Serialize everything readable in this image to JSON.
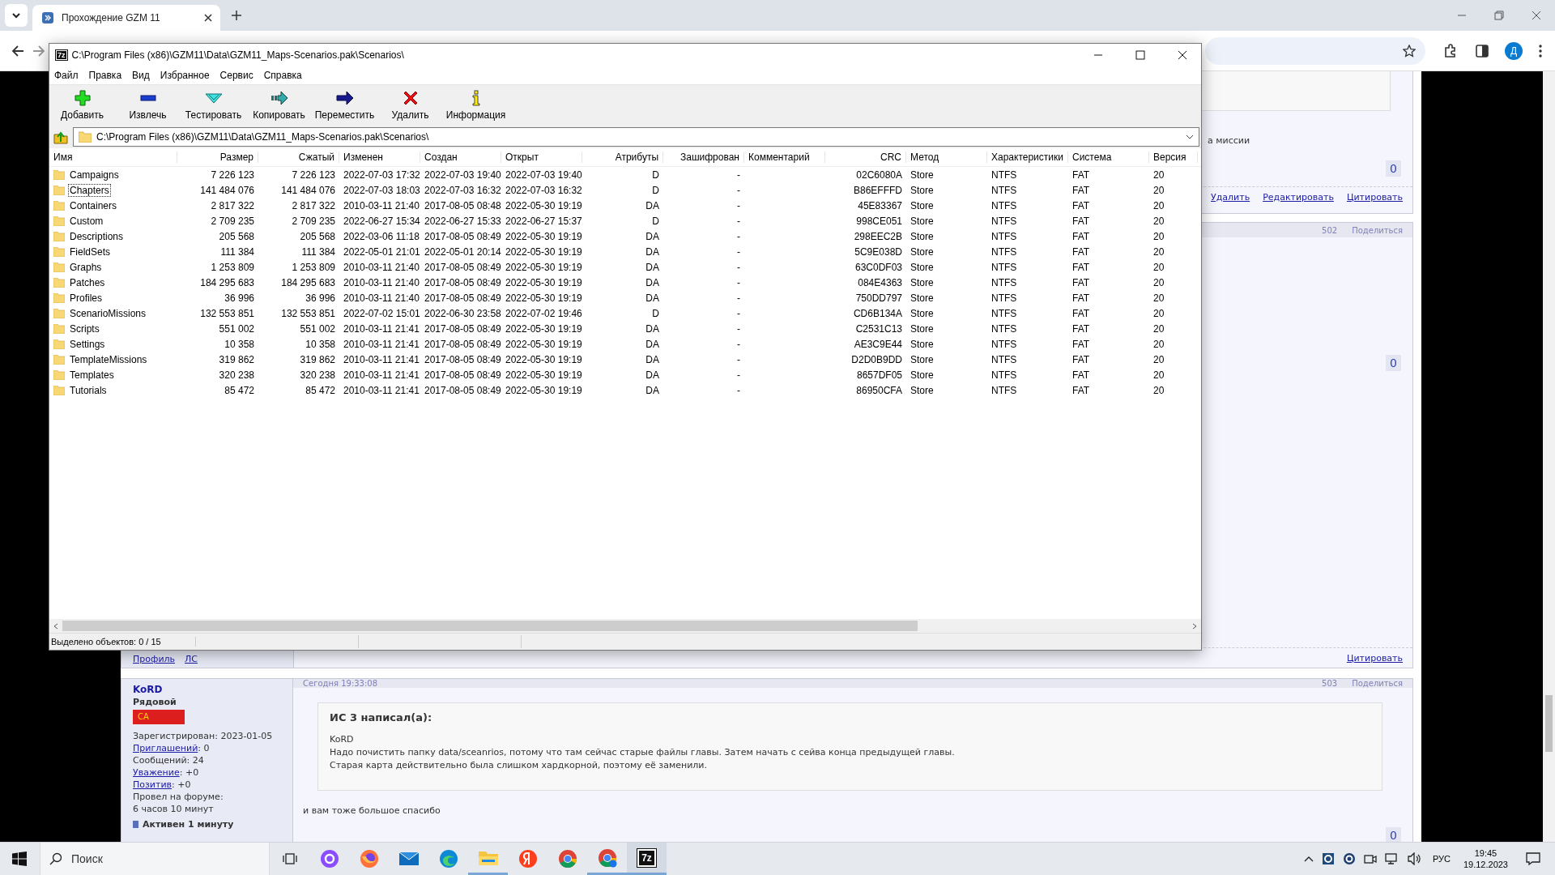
{
  "browser": {
    "tab": {
      "title": "Прохождение GZM 11"
    },
    "profile_initial": "Д"
  },
  "archiver": {
    "title_icon": "7z",
    "title": "C:\\Program Files (x86)\\GZM11\\Data\\GZM11_Maps-Scenarios.pak\\Scenarios\\",
    "menu": [
      "Файл",
      "Правка",
      "Вид",
      "Избранное",
      "Сервис",
      "Справка"
    ],
    "toolbar": [
      {
        "kind": "add",
        "label": "Добавить"
      },
      {
        "kind": "extract",
        "label": "Извлечь"
      },
      {
        "kind": "test",
        "label": "Тестировать"
      },
      {
        "kind": "copy",
        "label": "Копировать"
      },
      {
        "kind": "move",
        "label": "Переместить"
      },
      {
        "kind": "delete",
        "label": "Удалить"
      },
      {
        "kind": "info",
        "label": "Информация"
      }
    ],
    "path": "C:\\Program Files (x86)\\GZM11\\Data\\GZM11_Maps-Scenarios.pak\\Scenarios\\",
    "columns": [
      "Имя",
      "Размер",
      "Сжатый",
      "Изменен",
      "Создан",
      "Открыт",
      "Атрибуты",
      "Зашифрован",
      "Комментарий",
      "CRC",
      "Метод",
      "Характеристики",
      "Система",
      "Версия"
    ],
    "rows": [
      {
        "name": "Campaigns",
        "focused": false,
        "size": "7 226 123",
        "packed": "7 226 123",
        "modified": "2022-07-03 17:32",
        "created": "2022-07-03 19:40",
        "accessed": "2022-07-03 19:40",
        "attributes": "D",
        "encrypted": "-",
        "crc": "02C6080A",
        "method": "Store",
        "characteristics": "NTFS",
        "system": "FAT",
        "version": "20"
      },
      {
        "name": "Chapters",
        "focused": true,
        "size": "141 484 076",
        "packed": "141 484 076",
        "modified": "2022-07-03 18:03",
        "created": "2022-07-03 16:32",
        "accessed": "2022-07-03 16:32",
        "attributes": "D",
        "encrypted": "-",
        "crc": "B86EFFFD",
        "method": "Store",
        "characteristics": "NTFS",
        "system": "FAT",
        "version": "20"
      },
      {
        "name": "Containers",
        "focused": false,
        "size": "2 817 322",
        "packed": "2 817 322",
        "modified": "2010-03-11 21:40",
        "created": "2017-08-05 08:48",
        "accessed": "2022-05-30 19:19",
        "attributes": "DA",
        "encrypted": "-",
        "crc": "45E83367",
        "method": "Store",
        "characteristics": "NTFS",
        "system": "FAT",
        "version": "20"
      },
      {
        "name": "Custom",
        "focused": false,
        "size": "2 709 235",
        "packed": "2 709 235",
        "modified": "2022-06-27 15:34",
        "created": "2022-06-27 15:33",
        "accessed": "2022-06-27 15:37",
        "attributes": "D",
        "encrypted": "-",
        "crc": "998CE051",
        "method": "Store",
        "characteristics": "NTFS",
        "system": "FAT",
        "version": "20"
      },
      {
        "name": "Descriptions",
        "focused": false,
        "size": "205 568",
        "packed": "205 568",
        "modified": "2022-03-06 11:18",
        "created": "2017-08-05 08:49",
        "accessed": "2022-05-30 19:19",
        "attributes": "DA",
        "encrypted": "-",
        "crc": "298EEC2B",
        "method": "Store",
        "characteristics": "NTFS",
        "system": "FAT",
        "version": "20"
      },
      {
        "name": "FieldSets",
        "focused": false,
        "size": "111 384",
        "packed": "111 384",
        "modified": "2022-05-01 21:01",
        "created": "2022-05-01 20:14",
        "accessed": "2022-05-30 19:19",
        "attributes": "DA",
        "encrypted": "-",
        "crc": "5C9E038D",
        "method": "Store",
        "characteristics": "NTFS",
        "system": "FAT",
        "version": "20"
      },
      {
        "name": "Graphs",
        "focused": false,
        "size": "1 253 809",
        "packed": "1 253 809",
        "modified": "2010-03-11 21:40",
        "created": "2017-08-05 08:49",
        "accessed": "2022-05-30 19:19",
        "attributes": "DA",
        "encrypted": "-",
        "crc": "63C0DF03",
        "method": "Store",
        "characteristics": "NTFS",
        "system": "FAT",
        "version": "20"
      },
      {
        "name": "Patches",
        "focused": false,
        "size": "184 295 683",
        "packed": "184 295 683",
        "modified": "2010-03-11 21:40",
        "created": "2017-08-05 08:49",
        "accessed": "2022-05-30 19:19",
        "attributes": "DA",
        "encrypted": "-",
        "crc": "084E4363",
        "method": "Store",
        "characteristics": "NTFS",
        "system": "FAT",
        "version": "20"
      },
      {
        "name": "Profiles",
        "focused": false,
        "size": "36 996",
        "packed": "36 996",
        "modified": "2010-03-11 21:40",
        "created": "2017-08-05 08:49",
        "accessed": "2022-05-30 19:19",
        "attributes": "DA",
        "encrypted": "-",
        "crc": "750DD797",
        "method": "Store",
        "characteristics": "NTFS",
        "system": "FAT",
        "version": "20"
      },
      {
        "name": "ScenarioMissions",
        "focused": false,
        "size": "132 553 851",
        "packed": "132 553 851",
        "modified": "2022-07-02 15:01",
        "created": "2022-06-30 23:58",
        "accessed": "2022-07-02 19:46",
        "attributes": "D",
        "encrypted": "-",
        "crc": "CD6B134A",
        "method": "Store",
        "characteristics": "NTFS",
        "system": "FAT",
        "version": "20"
      },
      {
        "name": "Scripts",
        "focused": false,
        "size": "551 002",
        "packed": "551 002",
        "modified": "2010-03-11 21:41",
        "created": "2017-08-05 08:49",
        "accessed": "2022-05-30 19:19",
        "attributes": "DA",
        "encrypted": "-",
        "crc": "C2531C13",
        "method": "Store",
        "characteristics": "NTFS",
        "system": "FAT",
        "version": "20"
      },
      {
        "name": "Settings",
        "focused": false,
        "size": "10 358",
        "packed": "10 358",
        "modified": "2010-03-11 21:41",
        "created": "2017-08-05 08:49",
        "accessed": "2022-05-30 19:19",
        "attributes": "DA",
        "encrypted": "-",
        "crc": "AE3C9E44",
        "method": "Store",
        "characteristics": "NTFS",
        "system": "FAT",
        "version": "20"
      },
      {
        "name": "TemplateMissions",
        "focused": false,
        "size": "319 862",
        "packed": "319 862",
        "modified": "2010-03-11 21:41",
        "created": "2017-08-05 08:49",
        "accessed": "2022-05-30 19:19",
        "attributes": "DA",
        "encrypted": "-",
        "crc": "D2D0B9DD",
        "method": "Store",
        "characteristics": "NTFS",
        "system": "FAT",
        "version": "20"
      },
      {
        "name": "Templates",
        "focused": false,
        "size": "320 238",
        "packed": "320 238",
        "modified": "2010-03-11 21:41",
        "created": "2017-08-05 08:49",
        "accessed": "2022-05-30 19:19",
        "attributes": "DA",
        "encrypted": "-",
        "crc": "8657DF05",
        "method": "Store",
        "characteristics": "NTFS",
        "system": "FAT",
        "version": "20"
      },
      {
        "name": "Tutorials",
        "focused": false,
        "size": "85 472",
        "packed": "85 472",
        "modified": "2010-03-11 21:41",
        "created": "2017-08-05 08:49",
        "accessed": "2022-05-30 19:19",
        "attributes": "DA",
        "encrypted": "-",
        "crc": "86950CFA",
        "method": "Store",
        "characteristics": "NTFS",
        "system": "FAT",
        "version": "20"
      }
    ],
    "status": "Выделено объектов: 0 / 15"
  },
  "forum": {
    "posts": [
      {
        "kind": "partial",
        "snippet": "а миссии",
        "likes": "0",
        "actions": [
          "Удалить",
          "Редактировать",
          "Цитировать"
        ]
      },
      {
        "kind": "covered",
        "number": "502",
        "share": "Поделиться",
        "likes": "0",
        "profile_links": [
          "Профиль",
          "ЛС"
        ],
        "actions": [
          "Цитировать"
        ]
      },
      {
        "kind": "full",
        "number": "503",
        "share": "Поделиться",
        "date": "Сегодня 19:33:08",
        "author": "KoRD",
        "rank": "Рядовой",
        "flag": "СА",
        "info": [
          {
            "text": "Зарегистрирован: 2023-01-05"
          },
          {
            "link": "Приглашений",
            "text": ": 0"
          },
          {
            "text": "Сообщений: 24"
          },
          {
            "link": "Уважение",
            "text": ": +0"
          },
          {
            "link": "Позитив",
            "text": ": +0"
          },
          {
            "text": "Провел на форуме:"
          },
          {
            "text": "6 часов 10 минут"
          }
        ],
        "activity": "Активен 1 минуту",
        "quote": {
          "title": "ИС 3 написал(а):",
          "lines": [
            "KoRD",
            "Надо почистить папку data/sceanrios, потому что там сейчас старые файлы главы. Затем начать с сейва конца предыдущей главы.",
            "Старая карта действительно была слишком хардкорной, поэтому её заменили."
          ]
        },
        "text": "и вам тоже большое спасибо",
        "likes": "0"
      }
    ]
  },
  "taskbar": {
    "search_placeholder": "Поиск",
    "apps": [
      {
        "kind": "task-view",
        "running": false,
        "selected": false
      },
      {
        "kind": "assistant",
        "running": false,
        "selected": false
      },
      {
        "kind": "firefox",
        "running": false,
        "selected": false
      },
      {
        "kind": "mail",
        "running": false,
        "selected": false
      },
      {
        "kind": "edge",
        "running": false,
        "selected": false
      },
      {
        "kind": "explorer",
        "running": true,
        "selected": false
      },
      {
        "kind": "yandex",
        "running": false,
        "selected": false
      },
      {
        "kind": "chrome",
        "running": false,
        "selected": false
      },
      {
        "kind": "chrome-profile",
        "running": true,
        "selected": false
      },
      {
        "kind": "archiver",
        "label": "7z",
        "running": true,
        "selected": true
      }
    ],
    "language": "РУС",
    "time": "19:45",
    "date": "19.12.2023"
  }
}
